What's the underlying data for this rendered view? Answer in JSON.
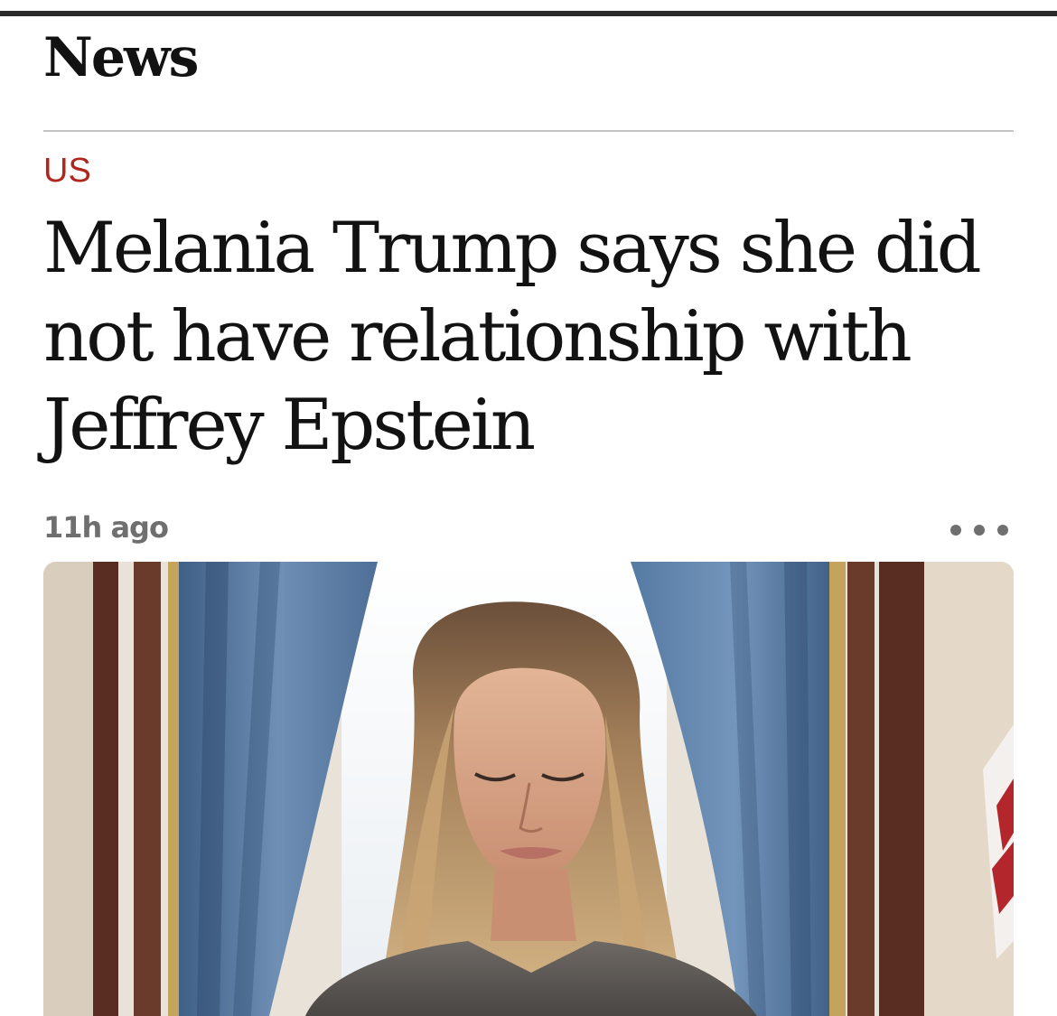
{
  "header": {
    "section_title": "News"
  },
  "article": {
    "kicker": "US",
    "headline": "Melania Trump says she did not have relationship with Jeffrey Epstein",
    "timestamp": "11h ago",
    "more_icon": "more-horizontal-icon"
  },
  "colors": {
    "kicker": "#b0251e",
    "text": "#121212",
    "meta": "#6f6f6f",
    "divider": "#c4c4c4"
  }
}
